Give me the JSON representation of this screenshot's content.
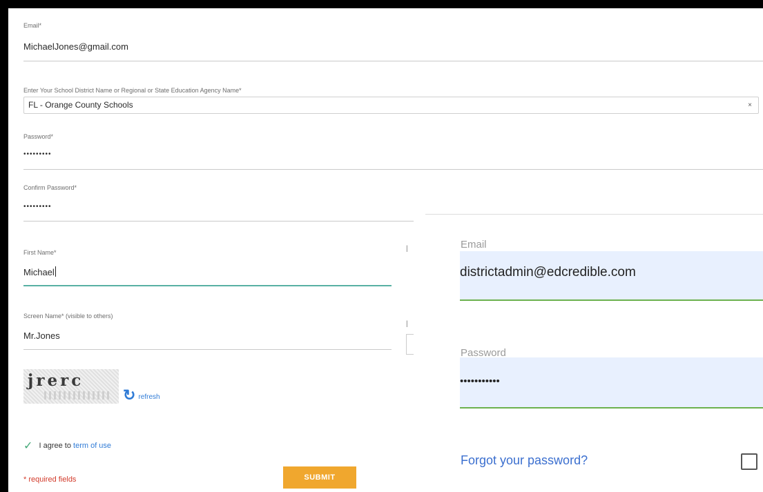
{
  "registration": {
    "email": {
      "label": "Email*",
      "value": "MichaelJones@gmail.com"
    },
    "district": {
      "label": "Enter Your School District Name or Regional or State Education Agency Name*",
      "value": "FL - Orange County Schools",
      "clear_icon": "×"
    },
    "password": {
      "label": "Password*",
      "value": "•••••••••"
    },
    "confirm_password": {
      "label": "Confirm Password*",
      "value": "•••••••••"
    },
    "first_name": {
      "label": "First Name*",
      "value": "Michael"
    },
    "screen_name": {
      "label": "Screen Name* (visible to others)",
      "value": "Mr.Jones"
    },
    "captcha": {
      "text": "jrerc",
      "refresh_icon": "↻",
      "refresh_label": "refresh"
    },
    "agree": {
      "check_icon": "✓",
      "text": "I agree to",
      "link": "term of use"
    },
    "required_note": "* required fields",
    "submit_label": "SUBMIT"
  },
  "login": {
    "email": {
      "label": "Email",
      "value": "districtadmin@edcredible.com"
    },
    "password": {
      "label": "Password",
      "value": "•••••••••••"
    },
    "forgot_password": "Forgot your password?"
  },
  "colors": {
    "submit": "#f0a72e",
    "link": "#2f7bd6",
    "required": "#d23a2a",
    "autofill": "#e8f0fe",
    "login_underline": "#6bb14d",
    "focus_underline": "#57b0a3"
  }
}
